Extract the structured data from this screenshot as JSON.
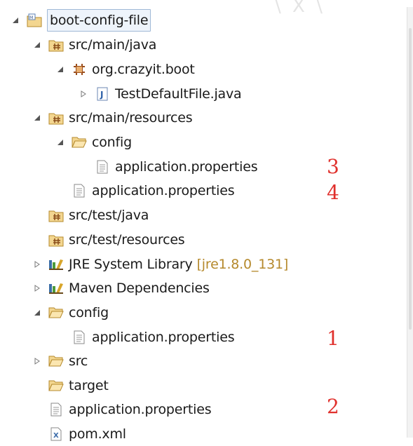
{
  "watermark": "\\ X \\",
  "tree": {
    "project": {
      "label": "boot-config-file"
    },
    "src_main_java": {
      "label": "src/main/java"
    },
    "pkg": {
      "label": "org.crazyit.boot"
    },
    "test_file": {
      "label": "TestDefaultFile.java"
    },
    "src_main_resources": {
      "label": "src/main/resources"
    },
    "res_config": {
      "label": "config"
    },
    "res_config_props": {
      "label": "application.properties",
      "annotation": "3"
    },
    "res_props": {
      "label": "application.properties",
      "annotation": "4"
    },
    "src_test_java": {
      "label": "src/test/java"
    },
    "src_test_resources": {
      "label": "src/test/resources"
    },
    "jre": {
      "label": "JRE System Library",
      "decoration": "[jre1.8.0_131]"
    },
    "maven": {
      "label": "Maven Dependencies"
    },
    "root_config": {
      "label": "config"
    },
    "root_config_props": {
      "label": "application.properties",
      "annotation": "1"
    },
    "src": {
      "label": "src"
    },
    "target": {
      "label": "target"
    },
    "root_props": {
      "label": "application.properties",
      "annotation": "2"
    },
    "pom": {
      "label": "pom.xml"
    }
  },
  "icons": {
    "expanded": "expanded-arrow-icon",
    "collapsed": "collapsed-arrow-icon",
    "project": "maven-project-icon",
    "source_folder": "source-folder-icon",
    "package": "package-icon",
    "java_file": "java-file-icon",
    "folder": "folder-icon",
    "properties": "properties-file-icon",
    "library": "library-icon",
    "xml": "xml-file-icon"
  },
  "colors": {
    "annotation": "#e0302c",
    "decoration": "#b5892c",
    "selection_border": "#9fb8d6",
    "arrow": "#555555"
  }
}
